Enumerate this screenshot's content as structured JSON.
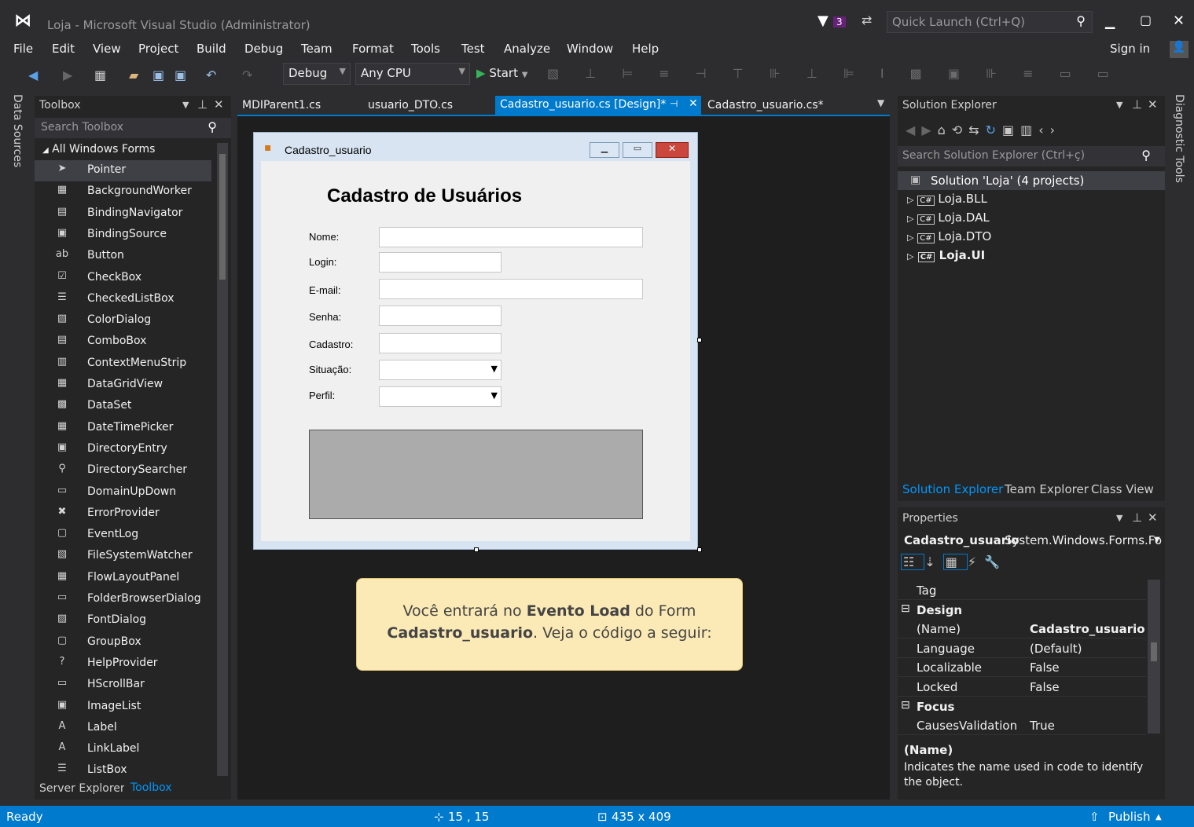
{
  "window": {
    "title": "Loja - Microsoft Visual Studio (Administrator)",
    "notification_count": "3",
    "quick_launch_placeholder": "Quick Launch (Ctrl+Q)",
    "sign_in": "Sign in"
  },
  "menu": [
    "File",
    "Edit",
    "View",
    "Project",
    "Build",
    "Debug",
    "Team",
    "Format",
    "Tools",
    "Test",
    "Analyze",
    "Window",
    "Help"
  ],
  "toolbar": {
    "config": "Debug",
    "platform": "Any CPU",
    "start": "Start"
  },
  "left_strip_label": "Data Sources",
  "right_strip_label": "Diagnostic Tools",
  "toolbox": {
    "title": "Toolbox",
    "search_placeholder": "Search Toolbox",
    "group": "All Windows Forms",
    "items": [
      {
        "label": "Pointer",
        "icon": "pointer-icon",
        "glyph": "➤"
      },
      {
        "label": "BackgroundWorker",
        "icon": "backgroundworker-icon",
        "glyph": "▦"
      },
      {
        "label": "BindingNavigator",
        "icon": "bindingnavigator-icon",
        "glyph": "▤"
      },
      {
        "label": "BindingSource",
        "icon": "bindingsource-icon",
        "glyph": "▣"
      },
      {
        "label": "Button",
        "icon": "button-icon",
        "glyph": "ab"
      },
      {
        "label": "CheckBox",
        "icon": "checkbox-icon",
        "glyph": "☑"
      },
      {
        "label": "CheckedListBox",
        "icon": "checkedlistbox-icon",
        "glyph": "☰"
      },
      {
        "label": "ColorDialog",
        "icon": "colordialog-icon",
        "glyph": "▧"
      },
      {
        "label": "ComboBox",
        "icon": "combobox-icon",
        "glyph": "▤"
      },
      {
        "label": "ContextMenuStrip",
        "icon": "contextmenustrip-icon",
        "glyph": "▥"
      },
      {
        "label": "DataGridView",
        "icon": "datagridview-icon",
        "glyph": "▦"
      },
      {
        "label": "DataSet",
        "icon": "dataset-icon",
        "glyph": "▩"
      },
      {
        "label": "DateTimePicker",
        "icon": "datetimepicker-icon",
        "glyph": "▦"
      },
      {
        "label": "DirectoryEntry",
        "icon": "directoryentry-icon",
        "glyph": "▣"
      },
      {
        "label": "DirectorySearcher",
        "icon": "directorysearcher-icon",
        "glyph": "⚲"
      },
      {
        "label": "DomainUpDown",
        "icon": "domainupdown-icon",
        "glyph": "▭"
      },
      {
        "label": "ErrorProvider",
        "icon": "errorprovider-icon",
        "glyph": "✖"
      },
      {
        "label": "EventLog",
        "icon": "eventlog-icon",
        "glyph": "▢"
      },
      {
        "label": "FileSystemWatcher",
        "icon": "filesystemwatcher-icon",
        "glyph": "▧"
      },
      {
        "label": "FlowLayoutPanel",
        "icon": "flowlayoutpanel-icon",
        "glyph": "▦"
      },
      {
        "label": "FolderBrowserDialog",
        "icon": "folderbrowserdialog-icon",
        "glyph": "▭"
      },
      {
        "label": "FontDialog",
        "icon": "fontdialog-icon",
        "glyph": "▨"
      },
      {
        "label": "GroupBox",
        "icon": "groupbox-icon",
        "glyph": "▢"
      },
      {
        "label": "HelpProvider",
        "icon": "helpprovider-icon",
        "glyph": "?"
      },
      {
        "label": "HScrollBar",
        "icon": "hscrollbar-icon",
        "glyph": "▭"
      },
      {
        "label": "ImageList",
        "icon": "imagelist-icon",
        "glyph": "▣"
      },
      {
        "label": "Label",
        "icon": "label-icon",
        "glyph": "A"
      },
      {
        "label": "LinkLabel",
        "icon": "linklabel-icon",
        "glyph": "A"
      },
      {
        "label": "ListBox",
        "icon": "listbox-icon",
        "glyph": "☰"
      }
    ],
    "bottom_tabs": [
      "Server Explorer",
      "Toolbox"
    ]
  },
  "editor": {
    "tabs": [
      "MDIParent1.cs",
      "usuario_DTO.cs",
      "Cadastro_usuario.cs [Design]*",
      "Cadastro_usuario.cs*"
    ]
  },
  "form": {
    "title": "Cadastro_usuario",
    "heading": "Cadastro de Usuários",
    "fields": [
      "Nome:",
      "Login:",
      "E-mail:",
      "Senha:",
      "Cadastro:",
      "Situação:",
      "Perfil:"
    ]
  },
  "callout": {
    "line1_a": "Você entrará no ",
    "line1_b": "Evento Load",
    "line1_c": " do Form",
    "line2_a": "Cadastro_usuario",
    "line2_b": ". Veja o código a seguir:"
  },
  "solution_explorer": {
    "title": "Solution Explorer",
    "search_placeholder": "Search Solution Explorer (Ctrl+ç)",
    "solution": "Solution 'Loja' (4 projects)",
    "projects": [
      "Loja.BLL",
      "Loja.DAL",
      "Loja.DTO",
      "Loja.UI"
    ],
    "bottom_tabs": [
      "Solution Explorer",
      "Team Explorer",
      "Class View"
    ]
  },
  "properties": {
    "title": "Properties",
    "object_name": "Cadastro_usuario",
    "object_type": "System.Windows.Forms.Fo",
    "rows": [
      {
        "k": "Tag",
        "v": ""
      },
      {
        "k": "Design",
        "v": "",
        "category": true
      },
      {
        "k": "(Name)",
        "v": "Cadastro_usuario"
      },
      {
        "k": "Language",
        "v": "(Default)"
      },
      {
        "k": "Localizable",
        "v": "False"
      },
      {
        "k": "Locked",
        "v": "False"
      },
      {
        "k": "Focus",
        "v": "",
        "category": true
      },
      {
        "k": "CausesValidation",
        "v": "True"
      }
    ],
    "desc_title": "(Name)",
    "desc_text": "Indicates the name used in code to identify the object."
  },
  "status": {
    "ready": "Ready",
    "position": "15 , 15",
    "size": "435 x 409",
    "publish": "Publish"
  }
}
